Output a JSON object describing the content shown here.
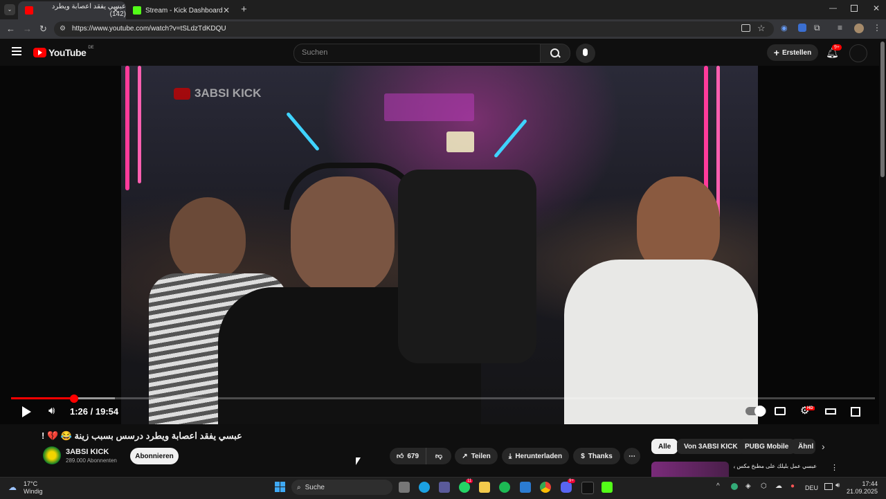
{
  "browser": {
    "tabs": [
      {
        "label": "عبسي يفقد اعصابة ويطرد (142)"
      },
      {
        "label": "Stream - Kick Dashboard"
      }
    ],
    "url": "https://www.youtube.com/watch?v=tSLdzTdKDQU"
  },
  "youtube": {
    "logo": "YouTube",
    "region": "DE",
    "search_placeholder": "Suchen",
    "create_label": "Erstellen",
    "notif_badge": "9+"
  },
  "player": {
    "time_display": "1:26 / 19:54",
    "progress": 0.073,
    "quality_badge": "HD",
    "watermark": "3ABSI KICK"
  },
  "video": {
    "title": "عبسي يفقد اعصابة ويطرد درسس بسبب زينة 😂 💔 !",
    "channel": "3ABSI KICK",
    "subscribers": "289.000 Abonnenten",
    "subscribe_label": "Abonnieren",
    "likes": "679",
    "share_label": "Teilen",
    "download_label": "Herunterladen",
    "thanks_label": "Thanks"
  },
  "chips": [
    "Alle",
    "Von 3ABSI KICK",
    "PUBG Mobile",
    "Ähnl"
  ],
  "sidebar_video": {
    "title": "عبسي عمل بليلك على مطبخ مكس بسبب"
  },
  "taskbar": {
    "weather_temp": "17°C",
    "weather_desc": "Windig",
    "search_label": "Suche",
    "lang": "DEU",
    "time": "17:44",
    "date": "21.09.2025",
    "badges": {
      "whatsapp": "11",
      "discord": "9+"
    }
  },
  "colors": {
    "accent": "#ff0000",
    "bg": "#0f0f0f"
  }
}
